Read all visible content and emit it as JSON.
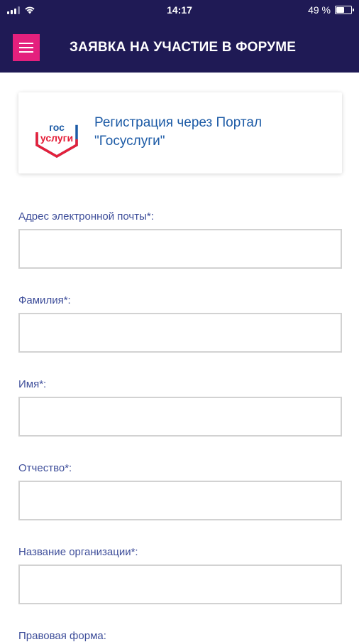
{
  "status_bar": {
    "time": "14:17",
    "battery": "49 %",
    "battery_level": 0.49
  },
  "header": {
    "title": "ЗАЯВКА НА УЧАСТИЕ В ФОРУМЕ",
    "menu_icon": "hamburger-menu-icon"
  },
  "gosuslugi": {
    "logo_line1": "гос",
    "logo_line2": "услуги",
    "text": "Регистрация через Портал \"Госуслуги\""
  },
  "form": {
    "email_label": "Адрес электронной почты*:",
    "email_value": "",
    "surname_label": "Фамилия*:",
    "surname_value": "",
    "name_label": "Имя*:",
    "name_value": "",
    "patronymic_label": "Отчество*:",
    "patronymic_value": "",
    "org_label": "Название организации*:",
    "org_value": "",
    "legal_form_label": "Правовая форма:"
  },
  "colors": {
    "header_bg": "#1f1a55",
    "menu_accent": "#e4207d",
    "label_color": "#3e4e9a",
    "gos_blue": "#1d5ba6",
    "gos_red": "#e4203a"
  }
}
